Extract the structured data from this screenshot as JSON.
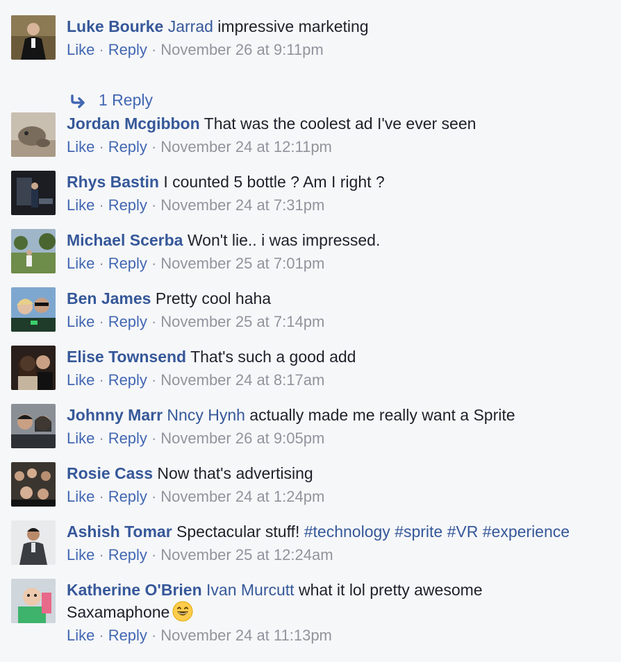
{
  "comments": [
    {
      "author": "Luke Bourke",
      "mention": "Jarrad",
      "text": " impressive marketing",
      "like": "Like",
      "reply": "Reply",
      "time": "November 26 at 9:11pm",
      "avatar": "avatar-luke",
      "replies": "1 Reply"
    },
    {
      "author": "Jordan Mcgibbon",
      "text": " That was the coolest ad I've ever seen",
      "like": "Like",
      "reply": "Reply",
      "time": "November 24 at 12:11pm",
      "avatar": "avatar-jordan"
    },
    {
      "author": "Rhys Bastin",
      "text": " I counted 5 bottle ? Am I right ?",
      "like": "Like",
      "reply": "Reply",
      "time": "November 24 at 7:31pm",
      "avatar": "avatar-rhys"
    },
    {
      "author": "Michael Scerba",
      "text": " Won't lie.. i was impressed.",
      "like": "Like",
      "reply": "Reply",
      "time": "November 25 at 7:01pm",
      "avatar": "avatar-michael"
    },
    {
      "author": "Ben James",
      "text": " Pretty cool haha",
      "like": "Like",
      "reply": "Reply",
      "time": "November 25 at 7:14pm",
      "avatar": "avatar-ben"
    },
    {
      "author": "Elise Townsend",
      "text": " That's such a good add",
      "like": "Like",
      "reply": "Reply",
      "time": "November 24 at 8:17am",
      "avatar": "avatar-elise"
    },
    {
      "author": "Johnny Marr",
      "mention": "Nncy Hynh",
      "text": " actually made me really want a Sprite",
      "like": "Like",
      "reply": "Reply",
      "time": "November 26 at 9:05pm",
      "avatar": "avatar-johnny"
    },
    {
      "author": "Rosie Cass",
      "text": " Now that's advertising",
      "like": "Like",
      "reply": "Reply",
      "time": "November 24 at 1:24pm",
      "avatar": "avatar-rosie"
    },
    {
      "author": "Ashish Tomar",
      "text": " Spectacular stuff! ",
      "hashtags": [
        "#technology",
        "#sprite",
        "#VR",
        "#experience"
      ],
      "like": "Like",
      "reply": "Reply",
      "time": "November 25 at 12:24am",
      "avatar": "avatar-ashish"
    },
    {
      "author": "Katherine O'Brien",
      "mention": "Ivan Murcutt",
      "text": " what it lol pretty awesome Saxamaphone",
      "emoji": "grinning-face-emoji",
      "like": "Like",
      "reply": "Reply",
      "time": "November 24 at 11:13pm",
      "avatar": "avatar-katherine"
    }
  ],
  "colors": {
    "link": "#365899",
    "action_link": "#4267b2",
    "meta": "#90949c",
    "background": "#f6f7f9"
  }
}
